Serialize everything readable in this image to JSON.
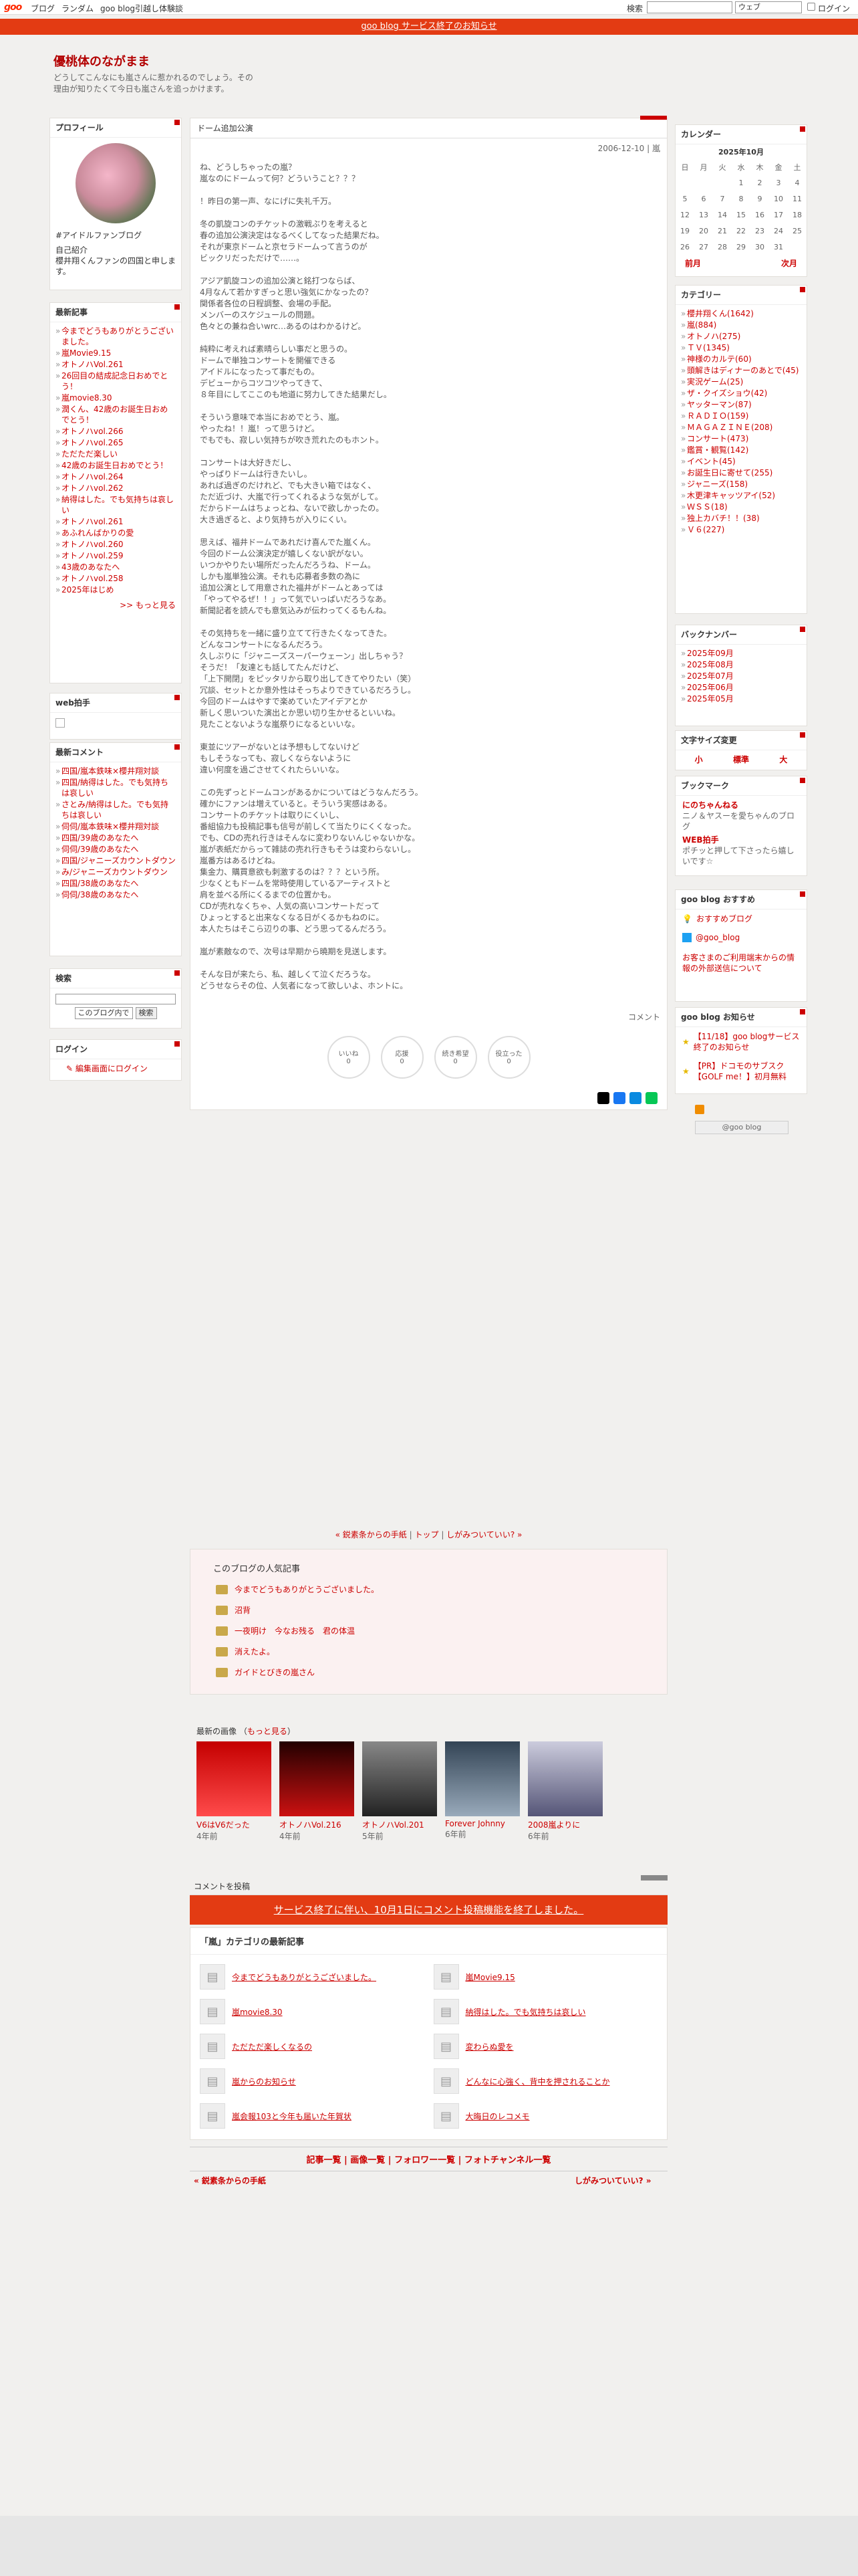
{
  "topbar": {
    "logo": "goo",
    "links": [
      "ブログ",
      "ランダム",
      "goo blog引越し体験談"
    ],
    "search_label": "検索",
    "search_select": "ウェブ",
    "login": "ログイン"
  },
  "notice": "goo blog サービス終了のお知らせ",
  "blog": {
    "title": "優桃体のながまま",
    "description": "どうしてこんなにも嵐さんに惹かれるのでしょう。その理由が知りたくて今日も嵐さんを追っかけます。"
  },
  "profile": {
    "title": "プロフィール",
    "link": "#アイドルファンブログ",
    "intro_label": "自己紹介",
    "intro": "櫻井翔くんファンの四国と申します。"
  },
  "recent": {
    "title": "最新記事",
    "items": [
      "今までどうもありがとうございました。",
      "嵐Movie9.15",
      "オトノハVol.261",
      "26回目の結成記念日おめでとう！",
      "嵐movie8.30",
      "潤くん、42歳のお誕生日おめでとう！",
      "オトノハvol.266",
      "オトノハvol.265",
      "ただただ楽しい",
      "42歳のお誕生日おめでとう！",
      "オトノハvol.264",
      "オトノハvol.262",
      "納得はした。でも気持ちは哀しい",
      "オトノハvol.261",
      "あふれんばかりの愛",
      "オトノハvol.260",
      "オトノハvol.259",
      "43歳のあなたへ",
      "オトノハvol.258",
      "2025年はじめ"
    ],
    "more": ">> もっと見る"
  },
  "web_clap": {
    "title": "web拍手"
  },
  "recent_comments": {
    "title": "最新コメント",
    "items": [
      "四国/嵐本鉄味×櫻井翔対談",
      "四国/納得はした。でも気持ちは哀しい",
      "さとみ/納得はした。でも気持ちは哀しい",
      "伺伺/嵐本鉄味×櫻井翔対談",
      "四国/39歳のあなたへ",
      "伺伺/39歳のあなたへ",
      "四国/ジャニーズカウントダウン",
      "み/ジャニーズカウントダウン",
      "四国/38歳のあなたへ",
      "伺伺/38歳のあなたへ"
    ]
  },
  "search": {
    "title": "検索",
    "select": "このブログ内で",
    "button": "検索"
  },
  "login": {
    "title": "ログイン",
    "link": "編集画面にログイン"
  },
  "article": {
    "category": "ドーム追加公演",
    "meta": "2006-12-10 | 嵐",
    "paragraphs": [
      "ね、どうしちゃったの嵐？\n嵐なのにドームって何？どういうこと？？？",
      "！昨日の第一声、なにげに失礼千万。",
      "冬の凱旋コンのチケットの激戦ぶりを考えると\n春の追加公演決定はなるべくしてなった結果だね。\nそれが東京ドームと京セラドームって言うのが\nビックリだっただけで……。",
      "アジア凱旋コンの追加公演と銘打つならば、\n4月なんて若かすぎっと思い強気にかなったの？\n関係者各位の日程調整、会場の手配。\nメンバーのスケジュールの問題。\n色々との兼ね合いwrc…あるのはわかるけど。",
      "純粋に考えれば素晴らしい事だと思うの。\nドームで単独コンサートを開催できる\nアイドルになったって事だもの。\nデビューからコツコツやってきて、\n８年目にしてここのも地道に努力してきた結果だし。",
      "そういう意味で本当におめでとう、嵐。\nやったね！！嵐！って思うけど。\nでもでも、寂しい気持ちが吹き荒れたのもホント。",
      "コンサートは大好きだし、\nやっぱりドームは行きたいし。\nあれば過ぎのだけれど、でも大きい箱ではなく、\nただ近づけ、大嵐で行ってくれるような気がして。\nだからドームはちょっとね、ないで欲しかったの。\n大き過ぎると、より気持ちが入りにくい。",
      "思えば、福井ドームであれだけ喜んでた嵐くん。\n今回のドーム公演決定が嬉しくない訳がない。\nいつかやりたい場所だったんだろうね、ドーム。\nしかも嵐単独公演。それも応募者多数の為に\n追加公演として用意された福井がドームとあっては\n「やってやるぜ！！」って気でいっぱいだろうなあ。\n新聞記者を読んでも意気込みが伝わってくるもんね。",
      "その気持ちを一緒に盛り立てて行きたくなってきた。\nどんなコンサートになるんだろう。\n久しぶりに「ジャニーズスーパーウェーン」出しちゃう？\nそうだ！「友達とも話してたんだけど、\n「上下開閉」をピッタリから取り出してきてやりたい（笑）\n冗談、セットとか意外性はそっちよりできているだろうし。\n今回のドームはやすで楽めていたアイデアとか\n新しく思いついた演出とか思い切り生かせるといいね。\n見たことないような嵐祭りになるといいな。",
      "東並にツアーがないとは予想もしてないけど\nもしそうなっても、寂しくならないように\n違い何度を過ごさせてくれたらいいな。",
      "この先ずっとドームコンがあるかについてはどうなんだろう。\n確かにファンは増えていると。そういう実感はある。\nコンサートのチケットは取りにくいし、\n番組協力も投稿記事も信号が前しくて当たりにくくなった。\nでも、CDの売れ行きはそんなに変わりないんじゃないかな。\n嵐が表紙だからって雑誌の売れ行きもそうは変わらないし。\n嵐番方はあるけどね。\n集金力、購買意欲も刺激するのは？？？という所。\n少なくともドームを常時使用しているアーティストと\n肩を並べる所にくるまでの位置かも。\nCDが売れなくちゃ、人気の高いコンサートだって\nひょっとすると出来なくなる日がくるかもねのに。\n本人たちはそこら辺りの事、どう思ってるんだろう。",
      "嵐が素敵なので、次号は早期から曉期を見送します。",
      "そんな日が来たら、私、越しくて泣くだろうな。\nどうせならその位、人気者になって欲しいよ、ホントに。"
    ],
    "comment_link": "コメント",
    "reactions": [
      {
        "label": "いいね",
        "count": "0"
      },
      {
        "label": "応援",
        "count": "0"
      },
      {
        "label": "続き希望",
        "count": "0"
      },
      {
        "label": "役立った",
        "count": "0"
      }
    ]
  },
  "pager": {
    "prev": "« 鋭素条からの手紙",
    "top": "トップ",
    "next": "しがみついていい? »"
  },
  "popular": {
    "title": "このブログの人気記事",
    "items": [
      "今までどうもありがとうございました。",
      "沼背",
      "一夜明け　今なお残る　君の体温",
      "消えたよ。",
      "ガイドとびきの嵐さん"
    ]
  },
  "latest_images": {
    "title": "最新の画像",
    "more": "もっと見る",
    "items": [
      {
        "caption": "V6はV6だった",
        "age": "4年前"
      },
      {
        "caption": "オトノハVol.216",
        "age": "4年前"
      },
      {
        "caption": "オトノハVol.201",
        "age": "5年前"
      },
      {
        "caption": "Forever Johnny",
        "age": "6年前"
      },
      {
        "caption": "2008嵐よりに",
        "age": "6年前"
      }
    ]
  },
  "comment_post": {
    "title": "コメントを投稿",
    "banner": "サービス終了に伴い、10月1日にコメント投稿機能を終了しました。"
  },
  "category_latest": {
    "title": "「嵐」カテゴリの最新記事",
    "items": [
      "今までどうもありがとうございました。",
      "嵐Movie9.15",
      "嵐movie8.30",
      "納得はした。でも気持ちは哀しい",
      "ただただ楽しくなるの",
      "変わらぬ愛を",
      "嵐からのお知らせ",
      "どんなに心強く、背中を押されることか",
      "嵐会報103と今年も届いた年賀状",
      "大晦日のレコメモ"
    ]
  },
  "footer": {
    "nav": "記事一覧 | 画像一覧 | フォロワー一覧 | フォトチャンネル一覧",
    "prev": "« 鋭素条からの手紙",
    "next": "しがみついていい? »"
  },
  "calendar": {
    "title": "カレンダー",
    "month": "2025年10月",
    "days": [
      "日",
      "月",
      "火",
      "水",
      "木",
      "金",
      "土"
    ],
    "weeks": [
      [
        "",
        "",
        "",
        "1",
        "2",
        "3",
        "4"
      ],
      [
        "5",
        "6",
        "7",
        "8",
        "9",
        "10",
        "11"
      ],
      [
        "12",
        "13",
        "14",
        "15",
        "16",
        "17",
        "18"
      ],
      [
        "19",
        "20",
        "21",
        "22",
        "23",
        "24",
        "25"
      ],
      [
        "26",
        "27",
        "28",
        "29",
        "30",
        "31",
        ""
      ]
    ],
    "prev": "前月",
    "next": "次月"
  },
  "categories": {
    "title": "カテゴリー",
    "items": [
      "櫻井翔くん(1642)",
      "嵐(884)",
      "オトノハ(275)",
      "ＴＶ(1345)",
      "神様のカルテ(60)",
      "頭解きはディナーのあとで(45)",
      "実況ゲーム(25)",
      "ザ・クイズショウ(42)",
      "ヤッターマン(87)",
      "ＲＡＤＩＯ(159)",
      "ＭＡＧＡＺＩＮＥ(208)",
      "コンサート(473)",
      "鑑賞・観覧(142)",
      "イベント(45)",
      "お誕生日に寄せて(255)",
      "ジャニーズ(158)",
      "木更津キャッツアイ(52)",
      "ＷＳＳ(18)",
      "独上カバチ！！(38)",
      "Ｖ６(227)"
    ]
  },
  "backnumber": {
    "title": "バックナンバー",
    "items": [
      "2025年09月",
      "2025年08月",
      "2025年07月",
      "2025年06月",
      "2025年05月"
    ]
  },
  "fontsize": {
    "title": "文字サイズ変更",
    "options": [
      "小",
      "標準",
      "大"
    ]
  },
  "bookmark": {
    "title": "ブックマーク",
    "items": [
      {
        "name": "にのちゃんねる",
        "desc": "ニノ＆ヤスーを愛ちゃんのブログ"
      },
      {
        "name": "WEB拍手",
        "desc": "ポチッと押して下さったら嬉しいです☆"
      }
    ]
  },
  "goo_recommend": {
    "title": "goo blog おすすめ",
    "items": [
      "おすすめブログ",
      "@goo_blog"
    ],
    "notice": "お客さまのご利用端末からの情報の外部送信について"
  },
  "goo_notice": {
    "title": "goo blog お知らせ",
    "items": [
      "【11/18】goo blogサービス終了のお知らせ",
      "【PR】ドコモのサブスク【GOLF me！】初月無料"
    ]
  },
  "goo_badge": "@goo blog"
}
